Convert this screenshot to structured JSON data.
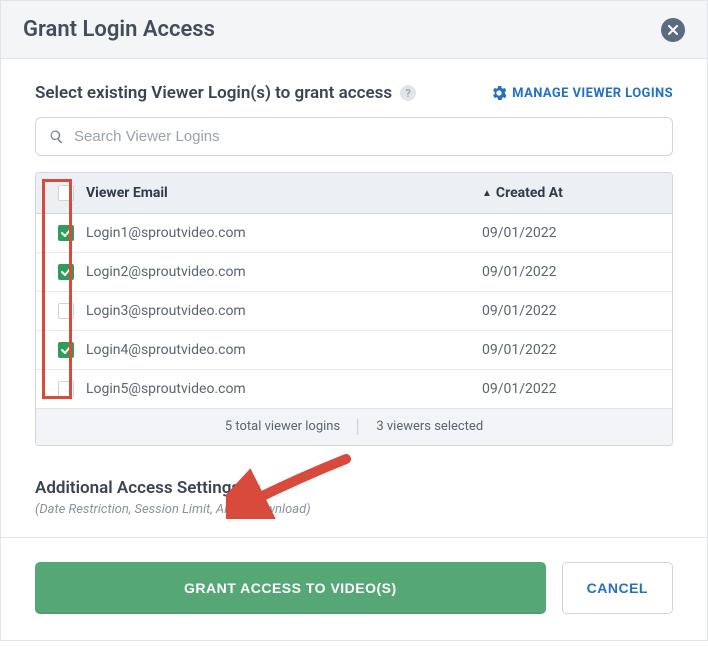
{
  "modal": {
    "title": "Grant Login Access",
    "close_label": "Close"
  },
  "section": {
    "label": "Select existing Viewer Login(s) to grant access",
    "manage_link": "MANAGE VIEWER LOGINS"
  },
  "search": {
    "placeholder": "Search Viewer Logins"
  },
  "table": {
    "col_email": "Viewer Email",
    "col_created": "Created At",
    "sort_dir": "asc",
    "rows": [
      {
        "email": "Login1@sproutvideo.com",
        "created": "09/01/2022",
        "checked": true
      },
      {
        "email": "Login2@sproutvideo.com",
        "created": "09/01/2022",
        "checked": true
      },
      {
        "email": "Login3@sproutvideo.com",
        "created": "09/01/2022",
        "checked": false
      },
      {
        "email": "Login4@sproutvideo.com",
        "created": "09/01/2022",
        "checked": true
      },
      {
        "email": "Login5@sproutvideo.com",
        "created": "09/01/2022",
        "checked": false
      }
    ],
    "footer_total": "5 total viewer logins",
    "footer_selected": "3 viewers selected"
  },
  "accordion": {
    "title": "Additional Access Settings",
    "subtitle": "(Date Restriction, Session Limit, Allow Download)"
  },
  "footer": {
    "primary": "GRANT ACCESS TO VIDEO(S)",
    "secondary": "CANCEL"
  },
  "annotations": {
    "checkbox_column_highlight": true,
    "arrow_points_to": "accordion-chevron"
  }
}
